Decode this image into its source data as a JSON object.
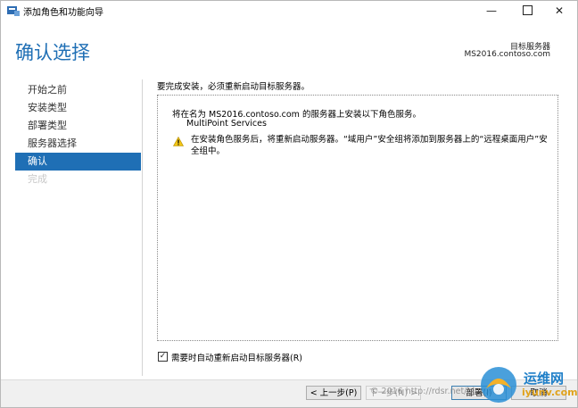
{
  "window": {
    "title": "添加角色和功能向导",
    "controls": {
      "minimize": "—",
      "close": "✕"
    }
  },
  "header": {
    "page_title": "确认选择",
    "target_label": "目标服务器",
    "target_value": "MS2016.contoso.com"
  },
  "nav": {
    "items": [
      {
        "label": "开始之前",
        "state": "normal"
      },
      {
        "label": "安装类型",
        "state": "normal"
      },
      {
        "label": "部署类型",
        "state": "normal"
      },
      {
        "label": "服务器选择",
        "state": "normal"
      },
      {
        "label": "确认",
        "state": "active"
      },
      {
        "label": "完成",
        "state": "disabled"
      }
    ]
  },
  "main": {
    "instruction": "要完成安装，必须重新启动目标服务器。",
    "install_line": "将在名为 MS2016.contoso.com 的服务器上安装以下角色服务。",
    "role": "MultiPoint Services",
    "warning": "在安装角色服务后，将重新启动服务器。“域用户”安全组将添加到服务器上的“远程桌面用户”安全组中。",
    "warning_icon": "warning-icon"
  },
  "restart_checkbox": {
    "checked": true,
    "mark": "✓",
    "label": "需要时自动重新启动目标服务器(R)"
  },
  "footer": {
    "prev_label": "< 上一步(P)",
    "next_label": "下一步(N) >",
    "install_label": "部署(I)",
    "cancel_label": "取消"
  },
  "watermark": {
    "url": "© 2016 http://rdsr.net/blog.com",
    "site_cn": "运维网",
    "site_en": "iyunv.com"
  },
  "colors": {
    "accent": "#1f6fb5",
    "nav_active_bg": "#1f6fb5",
    "footer_bg": "#f0f0f0"
  }
}
